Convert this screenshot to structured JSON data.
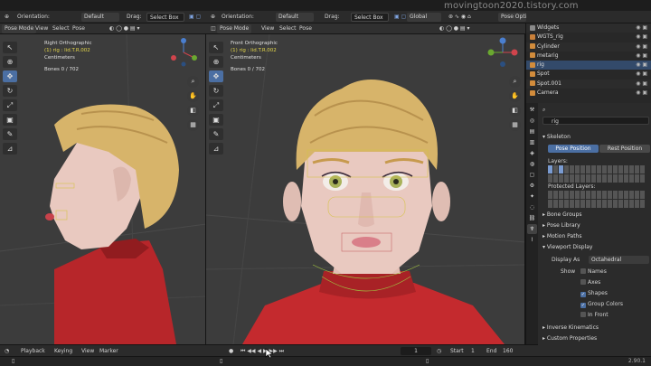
{
  "watermark": "movingtoon2020.tistory.com",
  "topbar": {
    "orientation_label": "Orientation:",
    "orientation_value": "Default",
    "drag_label": "Drag:",
    "drag_value": "Select Box",
    "orientation2_label": "Orientation:",
    "orientation2_value": "Default",
    "drag2_label": "Drag:",
    "drag2_value": "Select Box",
    "global_label": "Global",
    "pose_options_label": "Pose Opti"
  },
  "viewport_left": {
    "mode": "Pose Mode",
    "menu": [
      "View",
      "Select",
      "Pose"
    ],
    "view_name": "Right Orthographic",
    "object_info": "(1) rig : lid.T.R.002",
    "units": "Centimeters",
    "bones": "Bones      0 / 702"
  },
  "viewport_right": {
    "mode": "Pose Mode",
    "menu": [
      "View",
      "Select",
      "Pose"
    ],
    "view_name": "Front Orthographic",
    "object_info": "(1) rig : lid.T.R.002",
    "units": "Centimeters",
    "bones": "Bones      0 / 702"
  },
  "outliner": {
    "items": [
      {
        "name": "Widgets",
        "color": "#8a8a8a"
      },
      {
        "name": "WGTS_rig",
        "color": "#c9803a"
      },
      {
        "name": "Cylinder",
        "color": "#d28c3c"
      },
      {
        "name": "metarig",
        "color": "#d28c3c"
      },
      {
        "name": "rig",
        "color": "#d28c3c"
      },
      {
        "name": "Spot",
        "color": "#d28c3c"
      },
      {
        "name": "Spot.001",
        "color": "#d28c3c"
      },
      {
        "name": "Camera",
        "color": "#d28c3c"
      }
    ],
    "selected": "rig"
  },
  "properties": {
    "object_name": "rig",
    "skeleton_label": "Skeleton",
    "pose_position_label": "Pose Position",
    "rest_position_label": "Rest Position",
    "layers_label": "Layers:",
    "protected_layers_label": "Protected Layers:",
    "collapsed_sections": [
      "Bone Groups",
      "Pose Library",
      "Motion Paths"
    ],
    "viewport_display_label": "Viewport Display",
    "display_as_label": "Display As",
    "display_as_value": "Octahedral",
    "show_label": "Show",
    "show_options": [
      {
        "label": "Names",
        "checked": false
      },
      {
        "label": "Axes",
        "checked": false
      },
      {
        "label": "Shapes",
        "checked": true
      },
      {
        "label": "Group Colors",
        "checked": true
      },
      {
        "label": "In Front",
        "checked": false
      }
    ],
    "bottom_sections": [
      "Inverse Kinematics",
      "Custom Properties"
    ]
  },
  "timeline": {
    "playback_label": "Playback",
    "keying_label": "Keying",
    "view_label": "View",
    "marker_label": "Marker",
    "current_frame": "1",
    "start_label": "Start",
    "start_value": "1",
    "end_label": "End",
    "end_value": "160"
  },
  "status": {
    "version": "2.90.1"
  },
  "colors": {
    "accent": "#4b6fa3",
    "sweater": "#c42a2e",
    "skin": "#e9c9c0",
    "hair": "#d7b46a"
  }
}
